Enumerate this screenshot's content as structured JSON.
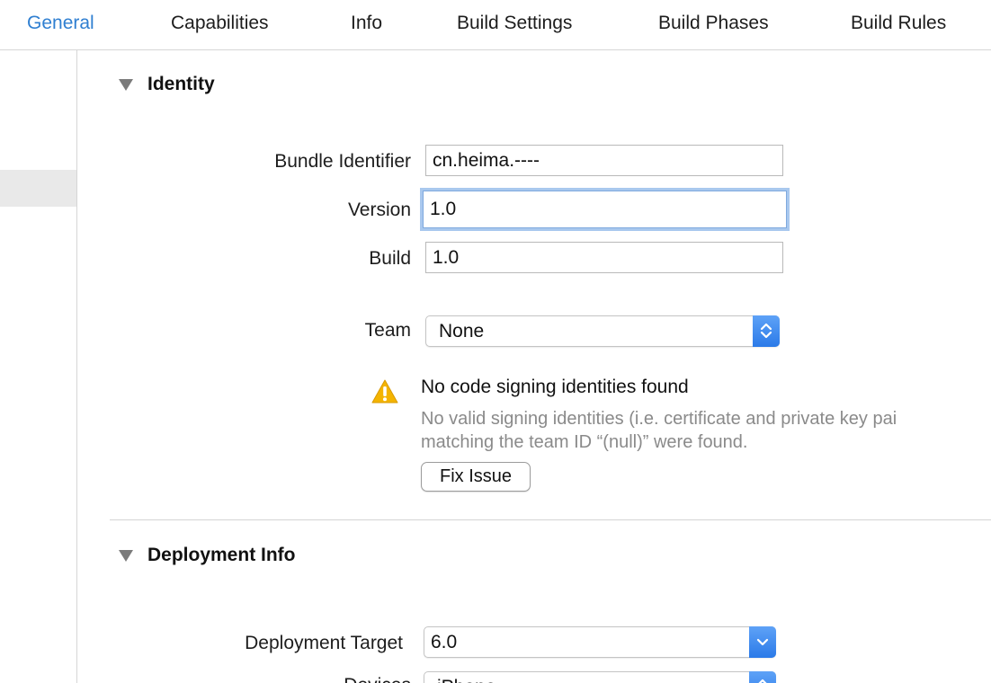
{
  "tabs": [
    {
      "label": "General",
      "active": true
    },
    {
      "label": "Capabilities"
    },
    {
      "label": "Info"
    },
    {
      "label": "Build Settings"
    },
    {
      "label": "Build Phases"
    },
    {
      "label": "Build Rules"
    }
  ],
  "identity": {
    "title": "Identity",
    "bundle_identifier_label": "Bundle Identifier",
    "bundle_identifier_value": "cn.heima.----",
    "version_label": "Version",
    "version_value": "1.0",
    "build_label": "Build",
    "build_value": "1.0",
    "team_label": "Team",
    "team_value": "None",
    "warning_title": "No code signing identities found",
    "warning_line1": "No valid signing identities (i.e. certificate and private key pai",
    "warning_line2": "matching the team ID “(null)” were found.",
    "fix_button": "Fix Issue"
  },
  "deployment": {
    "title": "Deployment Info",
    "target_label": "Deployment Target",
    "target_value": "6.0",
    "devices_label": "Devices",
    "devices_value": "iPhone"
  },
  "colors": {
    "accent": "#2f7fd1",
    "warning": "#f4b400"
  }
}
